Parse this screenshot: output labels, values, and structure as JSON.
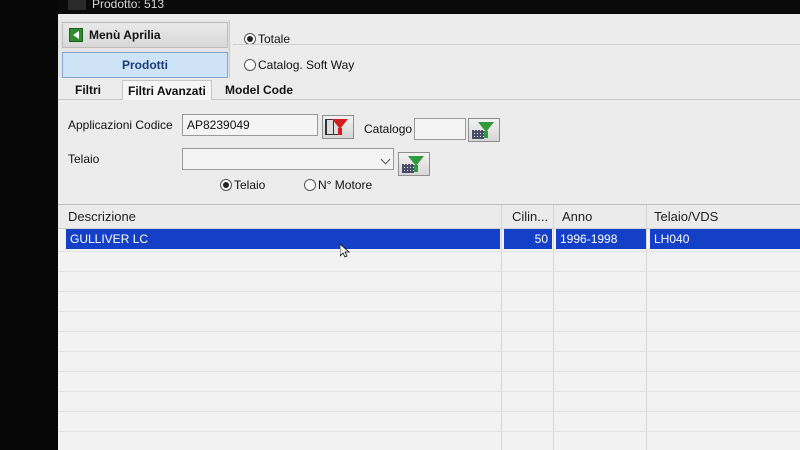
{
  "window": {
    "title": "Prodotto: 513"
  },
  "menu": {
    "header": "Menù Aprilia",
    "active_item": "Prodotti"
  },
  "catalog_mode": [
    {
      "label": "Totale",
      "checked": true
    },
    {
      "label": "Catalog. Soft Way",
      "checked": false
    }
  ],
  "tabs": [
    {
      "label": "Filtri",
      "active": false
    },
    {
      "label": "Filtri Avanzati",
      "active": true
    },
    {
      "label": "Model Code",
      "active": false
    }
  ],
  "filters": {
    "applicazioni_label": "Applicazioni Codice",
    "applicazioni_value": "AP8239049",
    "catalogo_label": "Catalogo",
    "catalogo_value": "",
    "telaio_label": "Telaio",
    "telaio_value": "",
    "search_by": [
      {
        "label": "Telaio",
        "checked": true
      },
      {
        "label": "N° Motore",
        "checked": false
      }
    ]
  },
  "table": {
    "columns": [
      "Descrizione",
      "Cilin...",
      "Anno",
      "Telaio/VDS"
    ],
    "rows": [
      {
        "descrizione": "GULLIVER LC",
        "cilindrata": "50",
        "anno": "1996-1998",
        "telaio": "LH040",
        "selected": true
      }
    ]
  },
  "colors": {
    "selection": "#1440c8",
    "filter_green": "#2e9a3a",
    "filter_red": "#d21e1e"
  },
  "icons": [
    "back-arrow-icon",
    "funnel-filter-icon",
    "calculator-icon",
    "grid-icon",
    "chevron-down-icon"
  ]
}
